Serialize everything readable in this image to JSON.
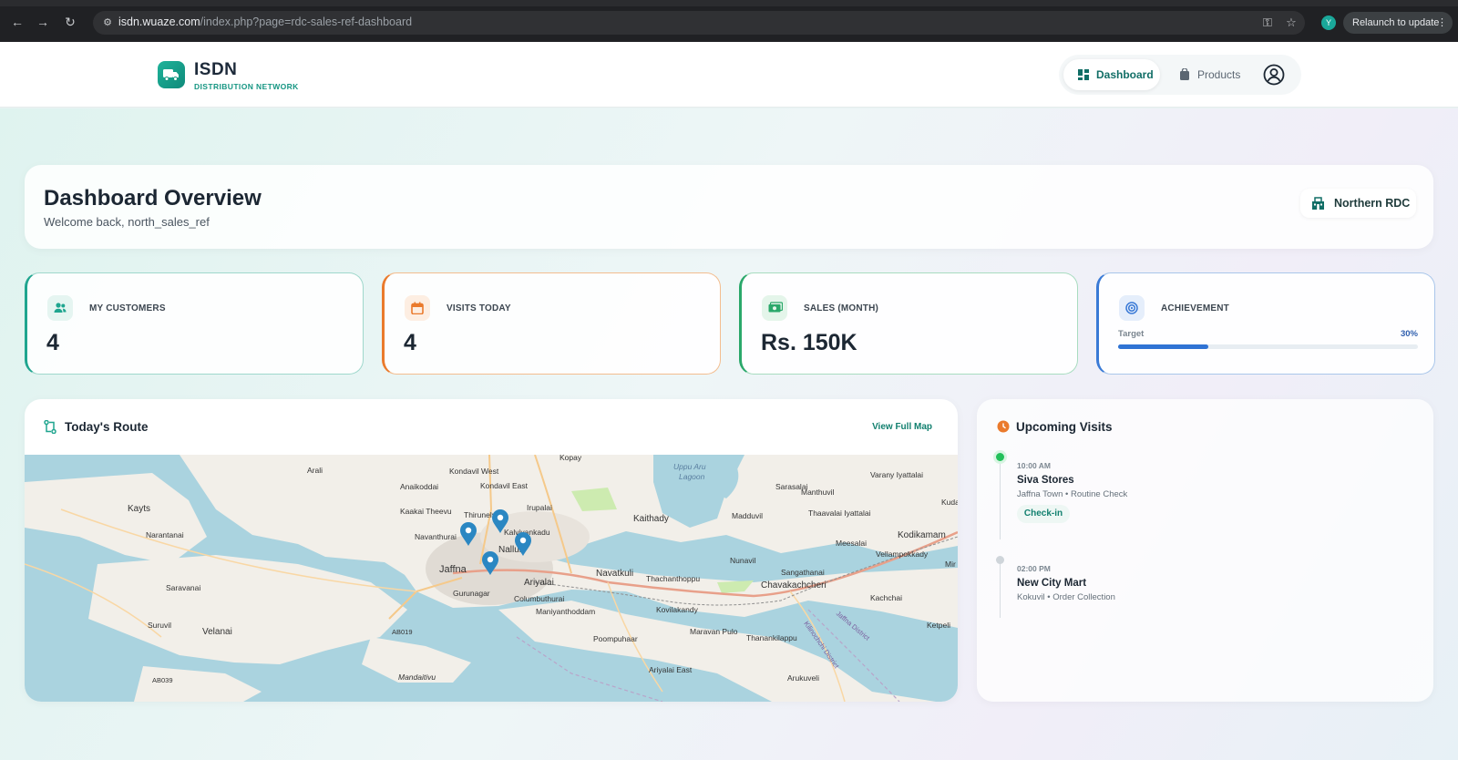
{
  "browser": {
    "url_host": "isdn.wuaze.com",
    "url_path": "/index.php?page=rdc-sales-ref-dashboard",
    "profile_initial": "Y",
    "relaunch_label": "Relaunch to update"
  },
  "header": {
    "brand": "ISDN",
    "brand_sub": "DISTRIBUTION NETWORK",
    "nav": {
      "dashboard": "Dashboard",
      "products": "Products"
    }
  },
  "overview": {
    "title": "Dashboard Overview",
    "welcome": "Welcome back, north_sales_ref",
    "region": "Northern RDC"
  },
  "stats": {
    "customers": {
      "label": "MY CUSTOMERS",
      "value": "4"
    },
    "visits": {
      "label": "VISITS TODAY",
      "value": "4"
    },
    "sales": {
      "label": "SALES (MONTH)",
      "value": "Rs. 150K"
    },
    "achievement": {
      "label": "ACHIEVEMENT",
      "target_label": "Target",
      "percent_text": "30%",
      "progress": 0.3
    }
  },
  "route": {
    "title": "Today's Route",
    "view_link": "View Full Map",
    "map_labels": {
      "kopay": "Kopay",
      "kondavil_west": "Kondavil West",
      "kondavil_east": "Kondavil East",
      "arali": "Arali",
      "anaikoddai": "Anaikoddai",
      "uppu_aru": "Uppu Aru",
      "lagoon": "Lagoon",
      "sarasalai": "Sarasalai",
      "varany": "Varany Iyattalai",
      "kuda": "Kuda",
      "kayts": "Kayts",
      "kaakai": "Kaakai Theevu",
      "thirunelvely": "Thirunelvely",
      "irupalai": "Irupalai",
      "kaithady": "Kaithady",
      "madduvil": "Madduvil",
      "manthuvil": "Manthuvil",
      "thaavalai": "Thaavalai Iyattalai",
      "narantanai": "Narantanai",
      "navanthurai": "Navanthurai",
      "kalviyankadu": "Kalviyankadu",
      "nallur": "Nallur",
      "meesalai": "Meesalai",
      "kodikamam": "Kodikamam",
      "vellampokkady": "Vellampokkady",
      "jaffna": "Jaffna",
      "ariyalai": "Ariyalai",
      "navatkuli": "Navatkuli",
      "nunavil": "Nunavil",
      "mir": "Mir",
      "saravanai": "Saravanai",
      "gurunagar": "Gurunagar",
      "columbuthurai": "Columbuthurai",
      "thachanthoppu": "Thachanthoppu",
      "sangathanai": "Sangathanai",
      "chavakachcheri": "Chavakachcheri",
      "kachchai": "Kachchai",
      "suruvil": "Suruvil",
      "velanai": "Velanai",
      "maniyanthoddam": "Maniyanthoddam",
      "kovilakandy": "Kovilakandy",
      "jaffna_district": "Jaffna District",
      "kilinochchi": "Kilinochchi District",
      "ketpeli": "Ketpeli",
      "ab019": "AB019",
      "poompuhaar": "Poompuhaar",
      "maravan_pulo": "Maravan Pulo",
      "thanankilappu": "Thanankilappu",
      "mandaitivu": "Mandaitivu",
      "ariyalai_east": "Ariyalai East",
      "arukuveli": "Arukuveli",
      "ab039": "AB039"
    }
  },
  "upcoming": {
    "title": "Upcoming Visits",
    "visits": [
      {
        "time": "10:00 AM",
        "name": "Siva Stores",
        "meta": "Jaffna Town • Routine Check",
        "action": "Check-in"
      },
      {
        "time": "02:00 PM",
        "name": "New City Mart",
        "meta": "Kokuvil • Order Collection"
      }
    ]
  },
  "colors": {
    "teal": "#1fa58f",
    "orange": "#ea7a2c",
    "green": "#2aa86a",
    "blue": "#3a7ad6"
  }
}
